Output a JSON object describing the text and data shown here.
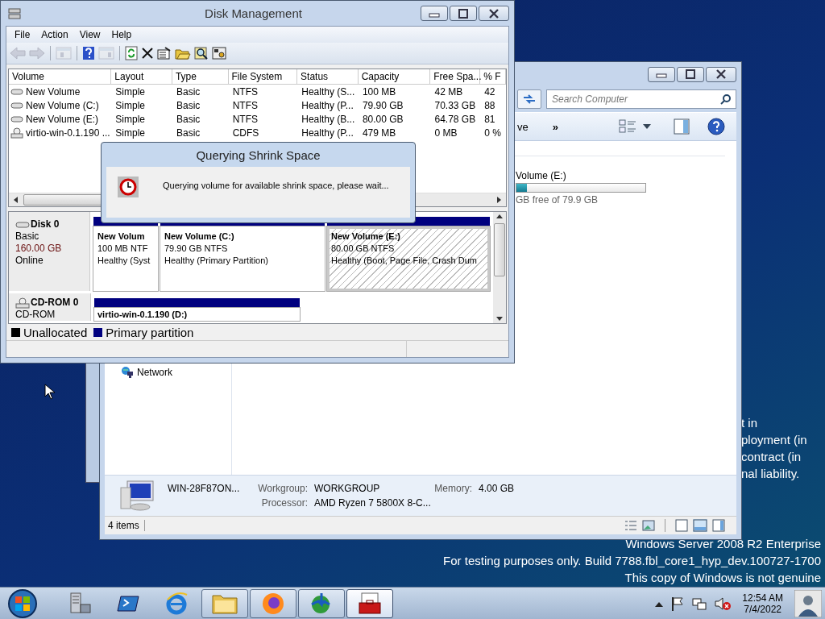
{
  "desktop": {
    "notice_fragments": [
      "t in",
      "ployment (in",
      "contract (in",
      "nal liability."
    ],
    "watermark": [
      "Windows Server 2008 R2 Enterprise",
      "For testing purposes only. Build 7788.fbl_core1_hyp_dev.100727-1700",
      "This copy of Windows is not genuine"
    ]
  },
  "explorer": {
    "search": {
      "placeholder": "Search Computer"
    },
    "toolbar": {
      "item": "ve",
      "more": "»"
    },
    "drive": {
      "name": "Volume (E:)",
      "level": 0.08,
      "free": "GB free of 79.9 GB"
    },
    "nav": [
      {
        "label": "Network"
      }
    ],
    "details": {
      "computer": "WIN-28F87ON...",
      "fields": [
        {
          "label": "Workgroup:",
          "value": "WORKGROUP"
        },
        {
          "label": "Memory:",
          "value": "4.00 GB"
        },
        {
          "label": "Processor:",
          "value": "AMD Ryzen 7 5800X 8-C..."
        }
      ]
    },
    "status": "4 items"
  },
  "disk_management": {
    "window": {
      "title": "Disk Management"
    },
    "menu": [
      "File",
      "Action",
      "View",
      "Help"
    ],
    "toolbar": [
      {
        "kind": "back",
        "disabled": true
      },
      {
        "kind": "forward",
        "disabled": true
      },
      {
        "kind": "tree",
        "disabled": true
      },
      {
        "kind": "help",
        "disabled": false
      },
      {
        "kind": "pane",
        "disabled": true
      },
      {
        "kind": "refresh",
        "disabled": false
      },
      {
        "kind": "delete",
        "disabled": false
      },
      {
        "kind": "properties",
        "disabled": false
      },
      {
        "kind": "open",
        "disabled": false
      },
      {
        "kind": "find",
        "disabled": false
      },
      {
        "kind": "options",
        "disabled": false
      }
    ],
    "table": {
      "columns": [
        "Volume",
        "Layout",
        "Type",
        "File System",
        "Status",
        "Capacity",
        "Free Spa...",
        "% F"
      ],
      "rows": [
        {
          "kind": "hdd",
          "cells": [
            "New Volume",
            "Simple",
            "Basic",
            "NTFS",
            "Healthy (S...",
            "100 MB",
            "42 MB",
            "42"
          ]
        },
        {
          "kind": "hdd",
          "cells": [
            "New Volume (C:)",
            "Simple",
            "Basic",
            "NTFS",
            "Healthy (P...",
            "79.90 GB",
            "70.33 GB",
            "88"
          ]
        },
        {
          "kind": "hdd",
          "cells": [
            "New Volume (E:)",
            "Simple",
            "Basic",
            "NTFS",
            "Healthy (B...",
            "80.00 GB",
            "64.78 GB",
            "81"
          ]
        },
        {
          "kind": "cd",
          "cells": [
            "virtio-win-0.1.190 ...",
            "Simple",
            "Basic",
            "CDFS",
            "Healthy (P...",
            "479 MB",
            "0 MB",
            "0 %"
          ]
        }
      ]
    },
    "disks": [
      {
        "kind": "hdd",
        "name": "Disk 0",
        "lines": [
          "Basic",
          "160.00 GB",
          "Online"
        ],
        "partitions": [
          {
            "name": "New Volum",
            "size": "100 MB NTF",
            "status": "Healthy (Syst",
            "selected": false
          },
          {
            "name": "New Volume  (C:)",
            "size": "79.90 GB NTFS",
            "status": "Healthy (Primary Partition)",
            "selected": false
          },
          {
            "name": "New Volume  (E:)",
            "size": "80.00 GB NTFS",
            "status": "Healthy (Boot, Page File, Crash Dum",
            "selected": true
          }
        ]
      },
      {
        "kind": "cd",
        "name": "CD-ROM 0",
        "lines": [
          "CD-ROM"
        ],
        "partitions": [
          {
            "name": "virtio-win-0.1.190  (D:)",
            "selected": false
          }
        ]
      }
    ],
    "legend": [
      {
        "label": "Unallocated",
        "color": "#000000"
      },
      {
        "label": "Primary partition",
        "color": "#00007f"
      }
    ]
  },
  "dialog": {
    "title": "Querying Shrink Space",
    "message": "Querying volume for available shrink space, please wait..."
  },
  "taskbar": {
    "items": [
      {
        "kind": "servers",
        "running": false,
        "selected": false
      },
      {
        "kind": "console",
        "running": false,
        "selected": false
      },
      {
        "kind": "browser",
        "running": false,
        "selected": false
      },
      {
        "kind": "folder",
        "running": true,
        "selected": false
      },
      {
        "kind": "fox",
        "running": true,
        "selected": false
      },
      {
        "kind": "globe",
        "running": true,
        "selected": false
      },
      {
        "kind": "toolbox",
        "running": true,
        "selected": true
      }
    ],
    "clock": {
      "time": "12:54 AM",
      "date": "7/4/2022"
    }
  }
}
